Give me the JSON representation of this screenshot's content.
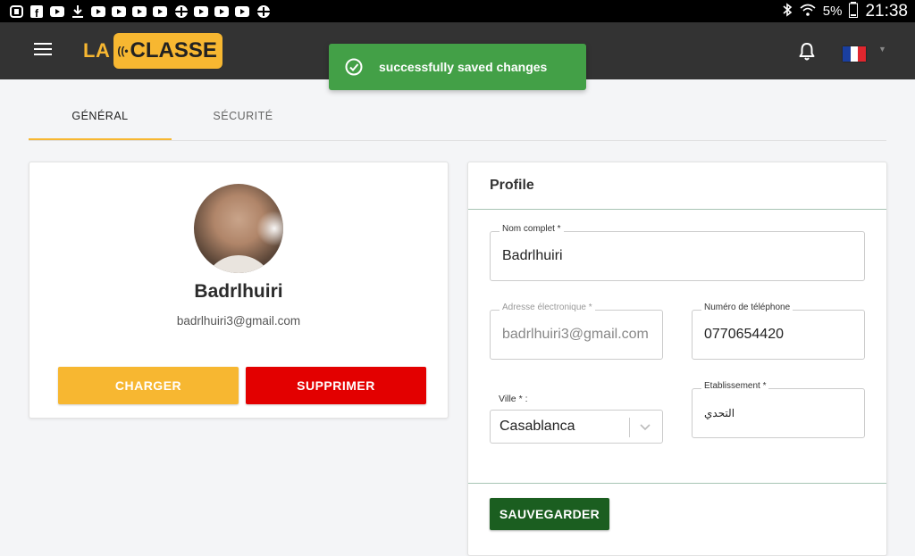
{
  "status_bar": {
    "left_icons": [
      "notification-icon",
      "facebook-icon",
      "youtube-icon",
      "download-icon",
      "youtube-icon",
      "youtube-icon",
      "youtube-icon",
      "youtube-icon",
      "airplane-icon",
      "youtube-icon",
      "youtube-icon",
      "youtube-icon",
      "airplane-icon"
    ],
    "battery": "5%",
    "time": "21:38"
  },
  "app_bar": {
    "logo_left": "LA",
    "logo_right": "CLASSE",
    "bg_color": "#333333",
    "accent_color": "#f7b731",
    "language_flag": "france-flag"
  },
  "toast": {
    "message": "successfully saved changes",
    "color": "#43a047"
  },
  "tabs": [
    {
      "label": "GÉNÉRAL",
      "active": true
    },
    {
      "label": "SÉCURITÉ",
      "active": false
    }
  ],
  "profile_card": {
    "name": "Badrlhuiri",
    "email": "badrlhuiri3@gmail.com",
    "upload_label": "CHARGER",
    "delete_label": "SUPPRIMER"
  },
  "form": {
    "title": "Profile",
    "full_name_label": "Nom complet *",
    "full_name_value": "Badrlhuiri",
    "email_label": "Adresse électronique *",
    "email_value": "badrlhuiri3@gmail.com",
    "phone_label": "Numéro de téléphone",
    "phone_value": "0770654420",
    "city_label": "Ville * :",
    "city_value": "Casablanca",
    "school_label": "Etablissement *",
    "school_value": "التحدي",
    "save_label": "SAUVEGARDER"
  }
}
